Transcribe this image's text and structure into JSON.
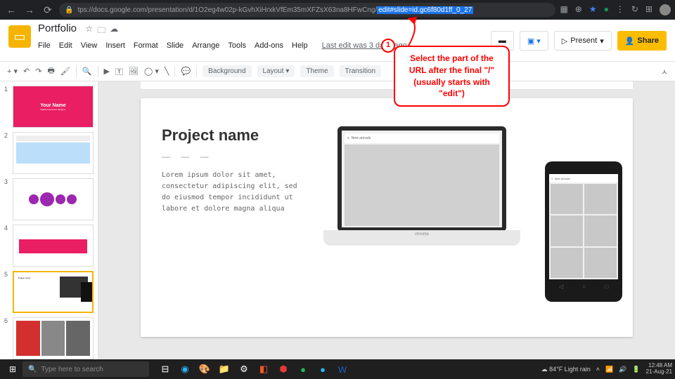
{
  "browser": {
    "url_prefix": "tps://docs.google.com/presentation/d/1O2eg4w02p-kGvhXiHrxkVfEm35mXFZsX63na8HFwCng/",
    "url_selected": "edit#slide=id.gc6f80d1ff_0_27"
  },
  "doc": {
    "title": "Portfolio",
    "last_edit": "Last edit was 3 days ago"
  },
  "menus": [
    "File",
    "Edit",
    "View",
    "Insert",
    "Format",
    "Slide",
    "Arrange",
    "Tools",
    "Add-ons",
    "Help"
  ],
  "header": {
    "present": "Present",
    "share": "Share"
  },
  "toolbar": {
    "background": "Background",
    "layout": "Layout",
    "theme": "Theme",
    "transition": "Transition"
  },
  "thumbs": {
    "t1_name": "Your Name",
    "t1_sub": "Digital experience designer",
    "laptop_bar": "New arrivals",
    "phone_bar": "New arrivals",
    "laptop_brand": "chrome"
  },
  "slide": {
    "title": "Project name",
    "lorem": "Lorem ipsum dolor sit amet, consectetur adipiscing elit, sed do eiusmod tempor incididunt ut labore et dolore magna aliqua"
  },
  "callout": {
    "num": "1",
    "text": "Select the part of the URL after the final \"/\" (usually starts with \"edit\")"
  },
  "taskbar": {
    "search_placeholder": "Type here to search",
    "weather": "84°F  Light rain",
    "time": "12:48 AM",
    "date": "21-Aug-21"
  }
}
